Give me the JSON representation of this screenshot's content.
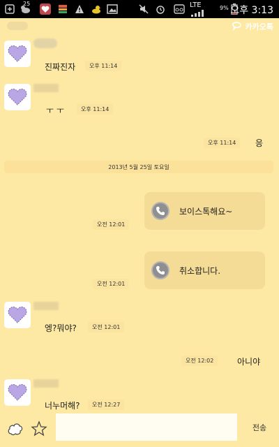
{
  "status_bar": {
    "clock": "오후 3:13",
    "network": "LTE",
    "battery": "9%",
    "notification_count": "25",
    "icons": [
      "plus-icon",
      "cat-icon",
      "heart-badge-icon",
      "gift-icon",
      "alert-icon",
      "duck-icon",
      "image-icon",
      "mute-icon",
      "alarm-icon",
      "voicemail-icon",
      "signal-icon",
      "battery-icon"
    ]
  },
  "header": {
    "brand": "카카오톡"
  },
  "chat": {
    "date_divider": "2013년 5월 25일 토요일",
    "messages": [
      {
        "side": "left",
        "text": "진짜진자",
        "time": "오후 11:14"
      },
      {
        "side": "left",
        "text": "ㅜ ㅜ",
        "time": "오후 11:14"
      },
      {
        "side": "right",
        "text": "응",
        "time": "오후 11:14"
      },
      {
        "side": "right",
        "type": "call",
        "text": "보이스톡해요~",
        "time": "오전 12:01"
      },
      {
        "side": "right",
        "type": "call",
        "text": "취소합니다.",
        "time": "오전 12:01"
      },
      {
        "side": "left",
        "text": "엥?뭐야?",
        "time": "오전 12:01"
      },
      {
        "side": "right",
        "text": "아니야",
        "time": "오전 12:02"
      },
      {
        "side": "left",
        "text": "너누머해?",
        "time": "오전 12:27"
      }
    ]
  },
  "input_bar": {
    "value": "",
    "placeholder": "",
    "send_label": "전송"
  },
  "colors": {
    "background": "#fde9a4",
    "bubble": "#f5dc96",
    "avatar_heart": "#b9a6e4"
  }
}
